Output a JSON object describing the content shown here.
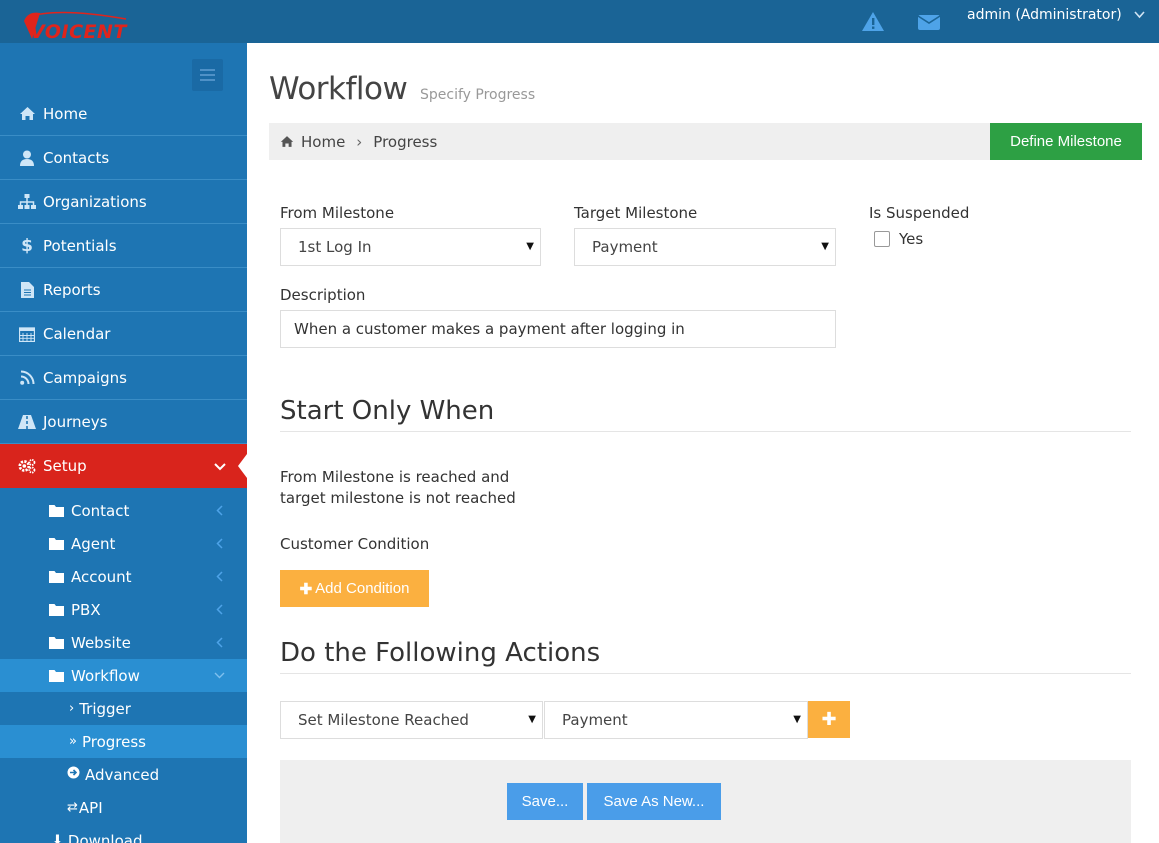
{
  "brand": {
    "logo_text": "VOICENT"
  },
  "topbar": {
    "user_label": "admin (Administrator)",
    "alert_icon": "warning-icon",
    "mail_icon": "envelope-icon"
  },
  "sidebar": {
    "items": [
      {
        "label": "Home",
        "icon": "home-icon"
      },
      {
        "label": "Contacts",
        "icon": "user-icon"
      },
      {
        "label": "Organizations",
        "icon": "sitemap-icon"
      },
      {
        "label": "Potentials",
        "icon": "dollar-icon"
      },
      {
        "label": "Reports",
        "icon": "file-icon"
      },
      {
        "label": "Calendar",
        "icon": "calendar-icon"
      },
      {
        "label": "Campaigns",
        "icon": "rss-icon"
      },
      {
        "label": "Journeys",
        "icon": "road-icon"
      },
      {
        "label": "Setup",
        "icon": "gears-icon"
      }
    ],
    "setup_items": [
      {
        "label": "Contact"
      },
      {
        "label": "Agent"
      },
      {
        "label": "Account"
      },
      {
        "label": "PBX"
      },
      {
        "label": "Website"
      },
      {
        "label": "Workflow"
      }
    ],
    "workflow_items": [
      {
        "label": "Trigger"
      },
      {
        "label": "Progress"
      },
      {
        "label": "Advanced"
      },
      {
        "label": "API"
      },
      {
        "label": "Download"
      }
    ]
  },
  "page": {
    "title": "Workflow",
    "subtitle": "Specify Progress"
  },
  "breadcrumb": {
    "home": "Home",
    "current": "Progress"
  },
  "define_milestone_label": "Define Milestone",
  "form": {
    "from_label": "From Milestone",
    "from_value": "1st Log In",
    "target_label": "Target Milestone",
    "target_value": "Payment",
    "suspended_label": "Is Suspended",
    "suspended_option": "Yes",
    "suspended_checked": false,
    "description_label": "Description",
    "description_value": "When a customer makes a payment after logging in"
  },
  "start_section": {
    "title": "Start Only When",
    "line1": "From Milestone is reached and",
    "line2": "target milestone is not reached",
    "condition_label": "Customer Condition",
    "add_condition_label": "Add Condition"
  },
  "actions_section": {
    "title": "Do the Following Actions",
    "action_value": "Set Milestone Reached",
    "action_target": "Payment"
  },
  "buttons": {
    "save": "Save...",
    "save_as_new": "Save As New..."
  }
}
